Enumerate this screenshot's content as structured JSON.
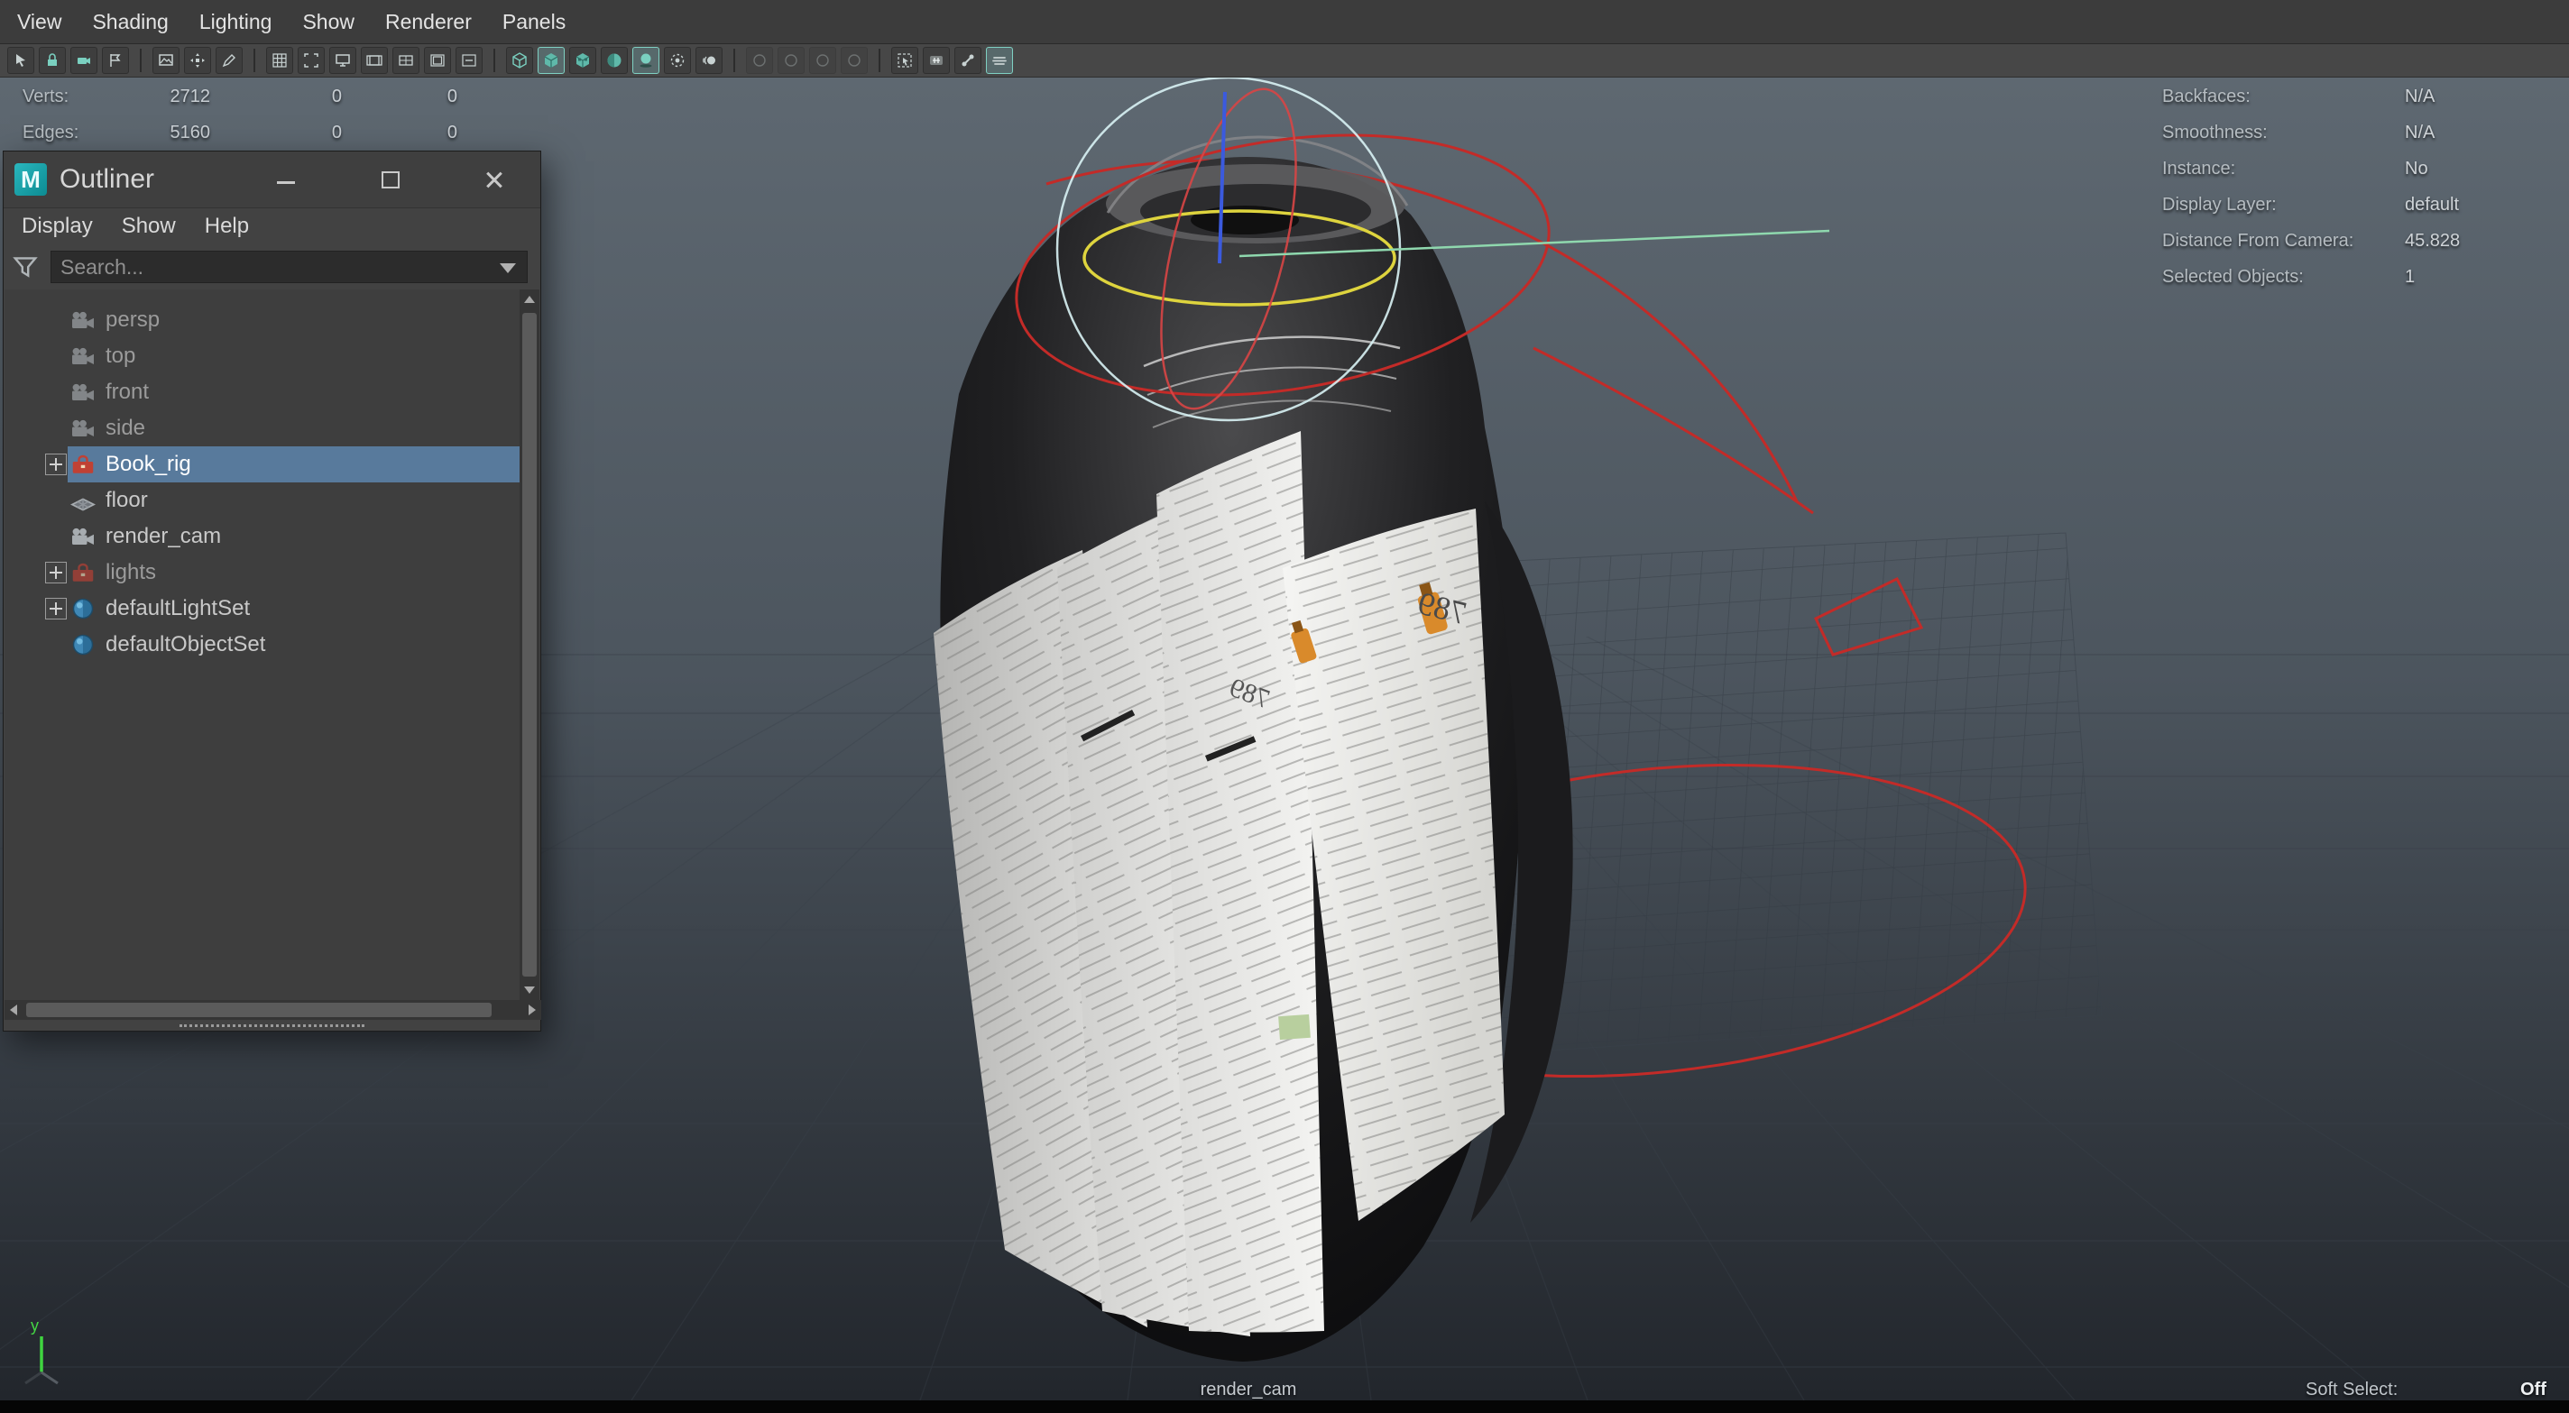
{
  "menubar": {
    "items": [
      "View",
      "Shading",
      "Lighting",
      "Show",
      "Renderer",
      "Panels"
    ]
  },
  "toolbar": {
    "groups": [
      {
        "icons": [
          {
            "name": "select-camera-icon",
            "shape": "cursor"
          },
          {
            "name": "lock-camera-icon",
            "shape": "lock"
          },
          {
            "name": "camera-attributes-icon",
            "shape": "camera"
          },
          {
            "name": "bookmark-icon",
            "shape": "flag"
          }
        ]
      },
      {
        "icons": [
          {
            "name": "image-plane-icon",
            "shape": "image"
          },
          {
            "name": "2d-pan-zoom-icon",
            "shape": "pan"
          },
          {
            "name": "grease-pencil-icon",
            "shape": "pencil"
          }
        ]
      },
      {
        "icons": [
          {
            "name": "grid-icon",
            "shape": "grid"
          },
          {
            "name": "film-gate-icon",
            "shape": "gate"
          },
          {
            "name": "resolution-gate-icon",
            "shape": "monitor"
          },
          {
            "name": "gate-mask-icon",
            "shape": "mask"
          },
          {
            "name": "field-chart-icon",
            "shape": "field"
          },
          {
            "name": "safe-action-icon",
            "shape": "safeaction"
          },
          {
            "name": "safe-title-icon",
            "shape": "safetitle"
          }
        ]
      },
      {
        "icons": [
          {
            "name": "wireframe-icon",
            "shape": "cubewire"
          },
          {
            "name": "smooth-shade-icon",
            "shape": "cubeshade",
            "active": true
          },
          {
            "name": "textured-icon",
            "shape": "cubetex"
          },
          {
            "name": "use-default-material-icon",
            "shape": "spherechk"
          },
          {
            "name": "shadows-icon",
            "shape": "shadow",
            "active": true
          },
          {
            "name": "screen-space-ao-icon",
            "shape": "aodot"
          },
          {
            "name": "motion-blur-icon",
            "shape": "mblur"
          }
        ]
      },
      {
        "icons": [
          {
            "name": "multisample-aa-icon",
            "shape": "dimdot",
            "disabled": true
          },
          {
            "name": "depth-of-field-icon",
            "shape": "dimdot",
            "disabled": true
          },
          {
            "name": "exposure-icon",
            "shape": "dimdot",
            "disabled": true
          },
          {
            "name": "gamma-icon",
            "shape": "dimdot",
            "disabled": true
          }
        ]
      },
      {
        "icons": [
          {
            "name": "isolate-select-icon",
            "shape": "isolate"
          },
          {
            "name": "xray-icon",
            "shape": "xray"
          },
          {
            "name": "xray-joints-icon",
            "shape": "bones"
          },
          {
            "name": "hardware-fog-icon",
            "shape": "fog",
            "active": true
          }
        ]
      }
    ]
  },
  "hud": {
    "left_rows": [
      {
        "label": "Verts:",
        "values": [
          "2712",
          "0",
          "0"
        ]
      },
      {
        "label": "Edges:",
        "values": [
          "5160",
          "0",
          "0"
        ]
      }
    ],
    "right_rows": [
      {
        "label": "Backfaces:",
        "value": "N/A"
      },
      {
        "label": "Smoothness:",
        "value": "N/A"
      },
      {
        "label": "Instance:",
        "value": "No"
      },
      {
        "label": "Display Layer:",
        "value": "default"
      },
      {
        "label": "Distance From Camera:",
        "value": "45.828"
      },
      {
        "label": "Selected Objects:",
        "value": "1"
      }
    ],
    "camera_label": "render_cam",
    "soft_select_label": "Soft Select:",
    "soft_select_value": "Off"
  },
  "outliner": {
    "title": "Outliner",
    "logo_letter": "M",
    "menu_items": [
      "Display",
      "Show",
      "Help"
    ],
    "search_placeholder": "Search...",
    "items": [
      {
        "label": "persp",
        "icon": "camera",
        "dim": true
      },
      {
        "label": "top",
        "icon": "camera",
        "dim": true
      },
      {
        "label": "front",
        "icon": "camera",
        "dim": true
      },
      {
        "label": "side",
        "icon": "camera",
        "dim": true
      },
      {
        "label": "Book_rig",
        "icon": "asset",
        "selected": true,
        "expandable": true
      },
      {
        "label": "floor",
        "icon": "mesh"
      },
      {
        "label": "render_cam",
        "icon": "camera"
      },
      {
        "label": "lights",
        "icon": "asset",
        "dim": true,
        "expandable": true
      },
      {
        "label": "defaultLightSet",
        "icon": "set",
        "expandable": true
      },
      {
        "label": "defaultObjectSet",
        "icon": "set"
      }
    ]
  },
  "scene": {
    "page_number": "789",
    "axis_label": "y"
  },
  "colors": {
    "selection": "#587a9c",
    "accent_teal": "#7ad0c0",
    "red_curve": "#c32b28",
    "manip_yellow": "#ded43e",
    "manip_blue": "#3b5ade"
  }
}
